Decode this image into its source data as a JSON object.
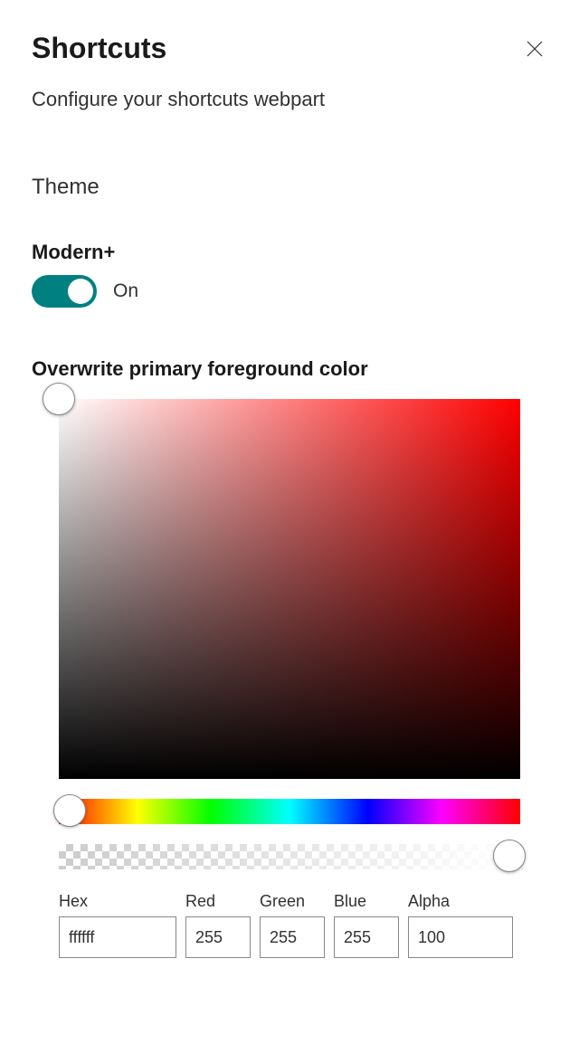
{
  "header": {
    "title": "Shortcuts",
    "subtitle": "Configure your shortcuts webpart"
  },
  "theme": {
    "heading": "Theme",
    "toggle": {
      "label": "Modern+",
      "state": "On",
      "on": true
    }
  },
  "colorPicker": {
    "label": "Overwrite primary foreground color",
    "fields": {
      "hex": {
        "label": "Hex",
        "value": "ffffff"
      },
      "red": {
        "label": "Red",
        "value": "255"
      },
      "green": {
        "label": "Green",
        "value": "255"
      },
      "blue": {
        "label": "Blue",
        "value": "255"
      },
      "alpha": {
        "label": "Alpha",
        "value": "100"
      }
    }
  },
  "colors": {
    "toggleOn": "#008080"
  }
}
